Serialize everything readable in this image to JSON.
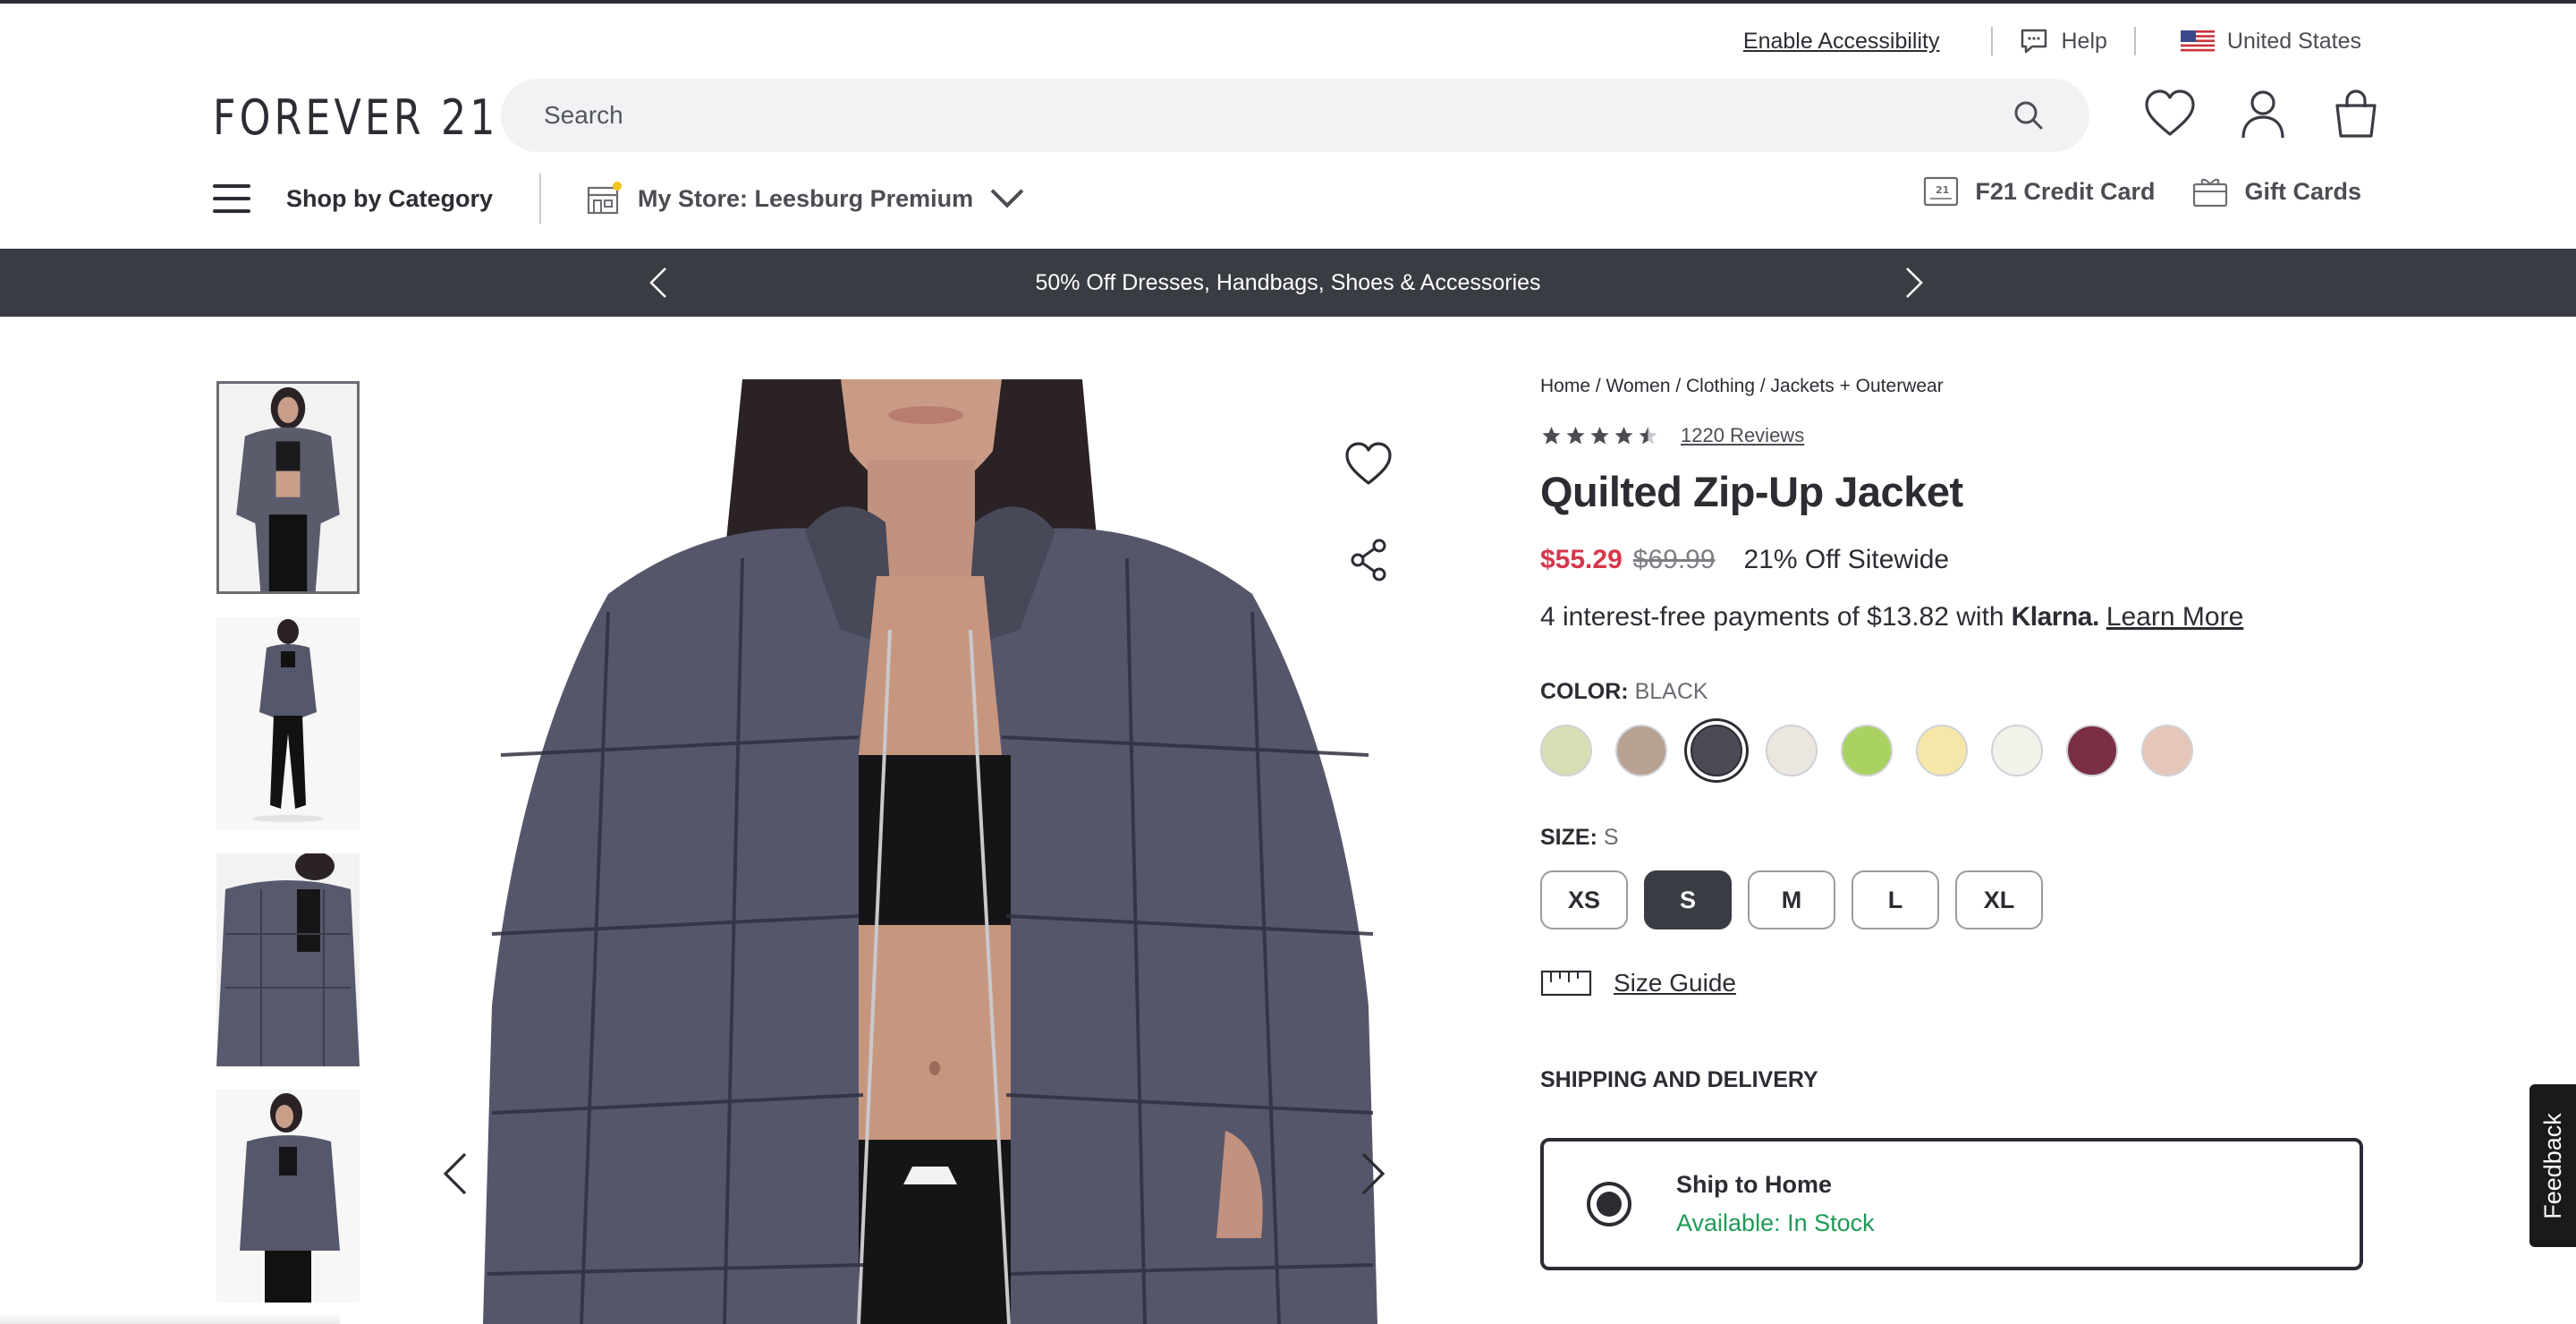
{
  "utility": {
    "accessibility": "Enable Accessibility",
    "help": "Help",
    "region": "United States"
  },
  "header": {
    "logo": "FOREVER 21",
    "search_placeholder": "Search",
    "icons": [
      "heart-icon",
      "account-icon",
      "bag-icon"
    ]
  },
  "nav": {
    "shop_by_category": "Shop by Category",
    "store": "My Store: Leesburg Premium",
    "credit_card": "F21 Credit Card",
    "gift_cards": "Gift Cards"
  },
  "promo": {
    "text": "50% Off Dresses, Handbags, Shoes & Accessories"
  },
  "gallery": {
    "thumbnail_count": 4,
    "active_index": 0
  },
  "product": {
    "breadcrumb": "Home / Women / Clothing / Jackets + Outerwear",
    "rating": 4.5,
    "reviews": "1220 Reviews",
    "title": "Quilted Zip-Up Jacket",
    "sale_price": "$55.29",
    "original_price": "$69.99",
    "discount": "21% Off Sitewide",
    "klarna_text": "4 interest-free payments of $13.82 with",
    "klarna_brand": "Klarna.",
    "learn_more": "Learn More",
    "color_label": "COLOR:",
    "color_value": "BLACK",
    "swatches": [
      "#d6dfb4",
      "#b8a294",
      "#4b4a55",
      "#ece6e0",
      "#a9d262",
      "#f6e7a8",
      "#f2f1ea",
      "#7a2f45",
      "#e6c6bb"
    ],
    "selected_swatch": 2,
    "size_label": "SIZE:",
    "size_value": "S",
    "sizes": [
      "XS",
      "S",
      "M",
      "L",
      "XL"
    ],
    "selected_size": 1,
    "size_guide": "Size Guide",
    "shipping_label": "SHIPPING AND DELIVERY",
    "ship_option": "Ship to Home",
    "availability": "Available:  In Stock"
  },
  "feedback": "Feedback"
}
